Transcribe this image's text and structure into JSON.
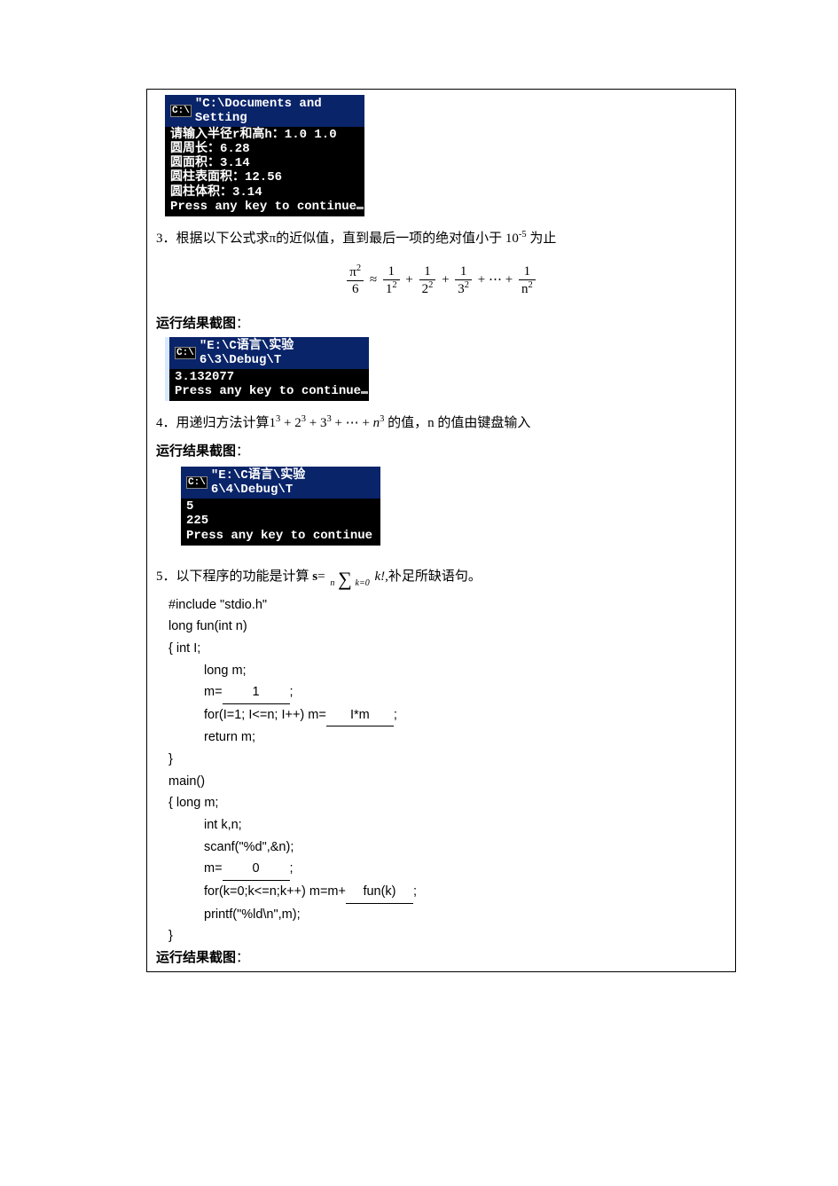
{
  "console1": {
    "title": "\"C:\\Documents and Setting",
    "lines": "请输入半径r和高h：1.0 1.0\n圆周长：6.28\n圆面积：3.14\n圆柱表面积：12.56\n圆柱体积：3.14\nPress any key to continue"
  },
  "q3": {
    "text": "3．根据以下公式求π的近似值，直到最后一项的绝对值小于 10",
    "exp": "-5",
    "text2": " 为止"
  },
  "result_label": "运行结果截图",
  "console2": {
    "title": "\"E:\\C语言\\实验6\\3\\Debug\\T",
    "lines": "3.132077\nPress any key to continue"
  },
  "q4": {
    "prefix": " 4．用递归方法计算",
    "suffix": "的值，n 的值由键盘输入"
  },
  "console3": {
    "title": "\"E:\\C语言\\实验6\\4\\Debug\\T",
    "lines": "5\n225\nPress any key to continue"
  },
  "q5": {
    "prefix": " 5．以下程序的功能是计算 ",
    "s": "s",
    "eq": "=",
    "kfact": "k!",
    "comma": ",",
    "suffix": "补足所缺语句。"
  },
  "code": {
    "l1": "#include \"stdio.h\"",
    "l2": "long fun(int n)",
    "l3": "{    int I;",
    "l4": "long m;",
    "l5a": "m=",
    "blank1": "1",
    "l5b": ";",
    "l6a": "for(I=1; I<=n; I++)    m=",
    "blank2": "I*m",
    "l6b": ";",
    "l7": "return m;",
    "l8": "}",
    "l9": "main()",
    "l10": "{    long m;",
    "l11": "int k,n;",
    "l12": "scanf(\"%d\",&n);",
    "l13a": "m=",
    "blank3": "0",
    "l13b": ";",
    "l14a": "for(k=0;k<=n;k++)   m=m+",
    "blank4": "fun(k)",
    "l14b": ";",
    "l15": "printf(\"%ld\\n\",m);",
    "l16": "}"
  },
  "colon": "："
}
